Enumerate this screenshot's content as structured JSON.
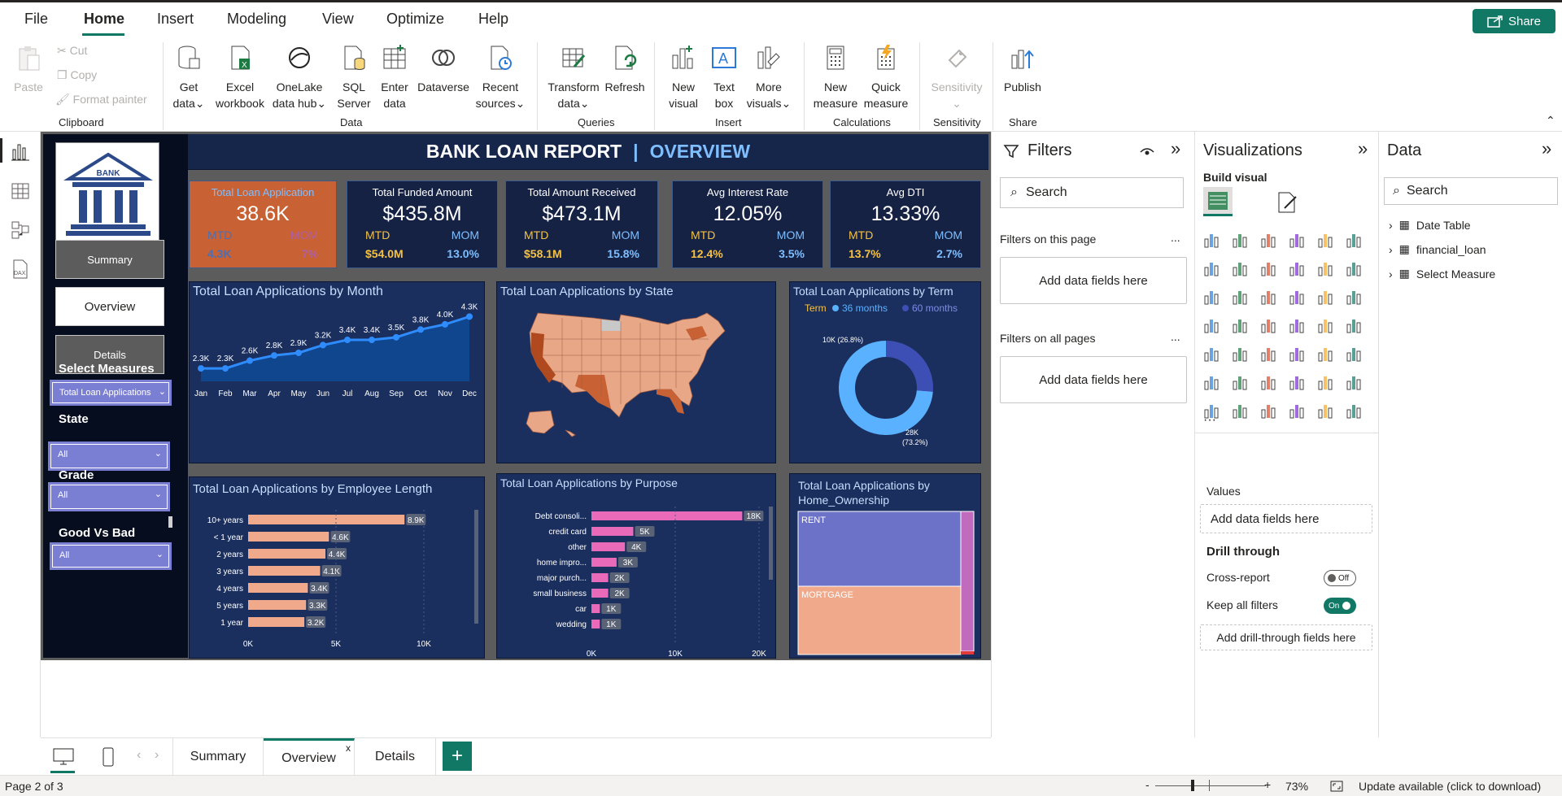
{
  "menu": {
    "file": "File",
    "home": "Home",
    "insert": "Insert",
    "modeling": "Modeling",
    "view": "View",
    "optimize": "Optimize",
    "help": "Help",
    "share": "Share"
  },
  "ribbon": {
    "paste": "Paste",
    "cut": "Cut",
    "copy": "Copy",
    "format_painter": "Format painter",
    "clipboard": "Clipboard",
    "get_data": [
      "Get",
      "data"
    ],
    "excel": [
      "Excel",
      "workbook"
    ],
    "onelake": [
      "OneLake",
      "data hub"
    ],
    "sql": [
      "SQL",
      "Server"
    ],
    "enter": [
      "Enter",
      "data"
    ],
    "dataverse": "Dataverse",
    "recent": [
      "Recent",
      "sources"
    ],
    "data_group": "Data",
    "transform": [
      "Transform",
      "data"
    ],
    "refresh": "Refresh",
    "queries": "Queries",
    "new_visual": [
      "New",
      "visual"
    ],
    "text_box": [
      "Text",
      "box"
    ],
    "more_visuals": [
      "More",
      "visuals"
    ],
    "insert": "Insert",
    "new_measure": [
      "New",
      "measure"
    ],
    "quick_measure": [
      "Quick",
      "measure"
    ],
    "calculations": "Calculations",
    "sensitivity": "Sensitivity",
    "sensitivity_group": "Sensitivity",
    "publish": "Publish",
    "share_group": "Share"
  },
  "report": {
    "title_a": "BANK LOAN REPORT",
    "title_sep": "|",
    "title_b": "OVERVIEW",
    "logo_text": "BANK",
    "nav": {
      "summary": "Summary",
      "overview": "Overview",
      "details": "Details"
    },
    "select_measures": "Select Measures",
    "select_measures_value": "Total Loan Applications",
    "state": "State",
    "state_value": "All",
    "grade": "Grade",
    "grade_value": "All",
    "goodbad": "Good Vs Bad",
    "goodbad_value": "All",
    "kpis": [
      {
        "title": "Total Loan Application",
        "value": "38.6K",
        "mtd_label": "MTD",
        "mom_label": "MOM",
        "mtd": "4.3K",
        "mom": "7%"
      },
      {
        "title": "Total Funded Amount",
        "value": "$435.8M",
        "mtd_label": "MTD",
        "mom_label": "MOM",
        "mtd": "$54.0M",
        "mom": "13.0%"
      },
      {
        "title": "Total  Amount Received",
        "value": "$473.1M",
        "mtd_label": "MTD",
        "mom_label": "MOM",
        "mtd": "$58.1M",
        "mom": "15.8%"
      },
      {
        "title": "Avg Interest Rate",
        "value": "12.05%",
        "mtd_label": "MTD",
        "mom_label": "MOM",
        "mtd": "12.4%",
        "mom": "3.5%"
      },
      {
        "title": "Avg DTI",
        "value": "13.33%",
        "mtd_label": "MTD",
        "mom_label": "MOM",
        "mtd": "13.7%",
        "mom": "2.7%"
      }
    ],
    "cards": {
      "month": "Total Loan Applications by Month",
      "state": "Total Loan Applications by State",
      "term": "Total Loan Applications by Term",
      "emp": "Total Loan Applications by Employee Length",
      "purpose": "Total Loan Applications by Purpose",
      "home_a": "Total Loan Applications by",
      "home_b": "Home_Ownership"
    }
  },
  "chart_data": [
    {
      "type": "area",
      "title": "Total Loan Applications by Month",
      "categories": [
        "Jan",
        "Feb",
        "Mar",
        "Apr",
        "May",
        "Jun",
        "Jul",
        "Aug",
        "Sep",
        "Oct",
        "Nov",
        "Dec"
      ],
      "values": [
        2.3,
        2.3,
        2.6,
        2.8,
        2.9,
        3.2,
        3.4,
        3.4,
        3.5,
        3.8,
        4.0,
        4.3
      ],
      "labels": [
        "2.3K",
        "2.3K",
        "2.6K",
        "2.8K",
        "2.9K",
        "3.2K",
        "3.4K",
        "3.4K",
        "3.5K",
        "3.8K",
        "4.0K",
        "4.3K"
      ],
      "unit": "K"
    },
    {
      "type": "pie",
      "title": "Total Loan Applications by Term",
      "legend_title": "Term",
      "categories": [
        "36 months",
        "60 months"
      ],
      "values": [
        28,
        10
      ],
      "labels": [
        "28K (73.2%)",
        "10K (26.8%)"
      ],
      "colors": [
        "#5ab1ff",
        "#3d4fb5"
      ]
    },
    {
      "type": "bar",
      "title": "Total Loan Applications by Employee Length",
      "categories": [
        "10+ years",
        "< 1 year",
        "2 years",
        "3 years",
        "4 years",
        "5 years",
        "1 year"
      ],
      "values": [
        8.9,
        4.6,
        4.4,
        4.1,
        3.4,
        3.3,
        3.2
      ],
      "labels": [
        "8.9K",
        "4.6K",
        "4.4K",
        "4.1K",
        "3.4K",
        "3.3K",
        "3.2K"
      ],
      "xticks": [
        "0K",
        "5K",
        "10K"
      ],
      "xlim": [
        0,
        10
      ],
      "color": "#f0a98a"
    },
    {
      "type": "bar",
      "title": "Total Loan Applications by Purpose",
      "categories": [
        "Debt consoli...",
        "credit card",
        "other",
        "home impro...",
        "major purch...",
        "small business",
        "car",
        "wedding"
      ],
      "values": [
        18,
        5,
        4,
        3,
        2,
        2,
        1,
        1
      ],
      "labels": [
        "18K",
        "5K",
        "4K",
        "3K",
        "2K",
        "2K",
        "1K",
        "1K"
      ],
      "xticks": [
        "0K",
        "10K",
        "20K"
      ],
      "xlim": [
        0,
        20
      ],
      "color": "#e86ab8"
    },
    {
      "type": "heatmap",
      "title": "Total Loan Applications by Home_Ownership",
      "categories": [
        "RENT",
        "MORTGAGE"
      ],
      "colors": [
        "#6b72c8",
        "#f0a98a",
        "#c06bbd"
      ]
    }
  ],
  "filters": {
    "title": "Filters",
    "search": "Search",
    "this_page": "Filters on this page",
    "all_pages": "Filters on all pages",
    "add": "Add data fields here",
    "more": "..."
  },
  "viz": {
    "title": "Visualizations",
    "build": "Build visual",
    "values": "Values",
    "add": "Add data fields here",
    "drill": "Drill through",
    "cross": "Cross-report",
    "cross_state": "Off",
    "keep": "Keep all filters",
    "keep_state": "On",
    "add_drill": "Add drill-through fields here"
  },
  "data": {
    "title": "Data",
    "search": "Search",
    "tables": [
      "Date Table",
      "financial_loan",
      "Select Measure"
    ]
  },
  "tabs": {
    "summary": "Summary",
    "overview": "Overview",
    "details": "Details",
    "add": "+"
  },
  "status": {
    "page": "Page 2 of 3",
    "zoom": "73%",
    "update": "Update available (click to download)",
    "minus": "-",
    "plus": "+"
  }
}
